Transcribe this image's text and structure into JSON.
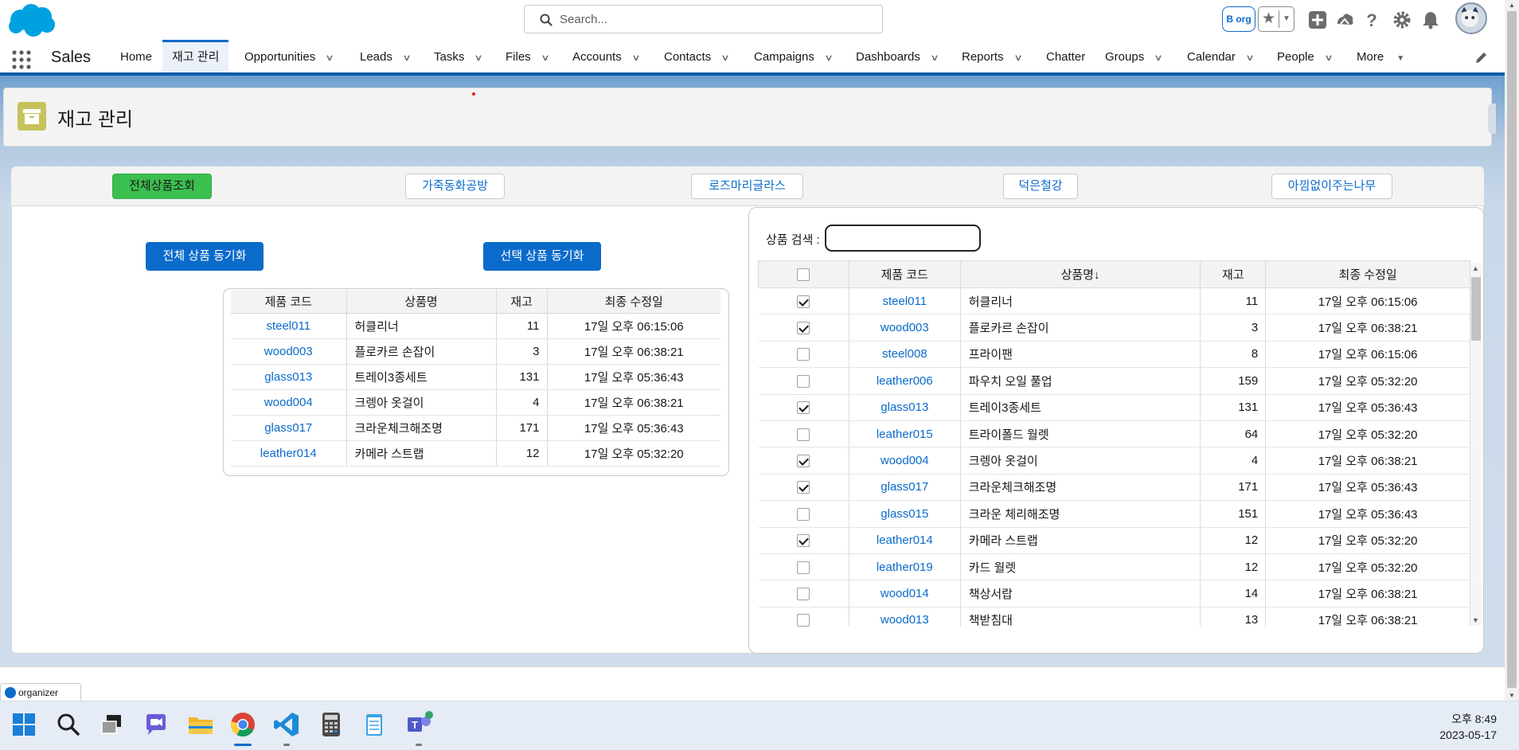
{
  "header": {
    "search_placeholder": "Search...",
    "org_badge": "B org"
  },
  "nav": {
    "app_name": "Sales",
    "items": [
      {
        "label": "Home",
        "dropdown": false
      },
      {
        "label": "재고 관리",
        "dropdown": false,
        "active": true
      },
      {
        "label": "Opportunities",
        "dropdown": true
      },
      {
        "label": "Leads",
        "dropdown": true
      },
      {
        "label": "Tasks",
        "dropdown": true
      },
      {
        "label": "Files",
        "dropdown": true
      },
      {
        "label": "Accounts",
        "dropdown": true
      },
      {
        "label": "Contacts",
        "dropdown": true
      },
      {
        "label": "Campaigns",
        "dropdown": true
      },
      {
        "label": "Dashboards",
        "dropdown": true
      },
      {
        "label": "Reports",
        "dropdown": true
      },
      {
        "label": "Chatter",
        "dropdown": false
      },
      {
        "label": "Groups",
        "dropdown": true
      },
      {
        "label": "Calendar",
        "dropdown": true
      },
      {
        "label": "People",
        "dropdown": true
      },
      {
        "label": "More",
        "dropdown": true
      }
    ]
  },
  "page": {
    "title": "재고 관리"
  },
  "tabs": [
    {
      "label": "전체상품조회",
      "active": true
    },
    {
      "label": "가죽동화공방",
      "active": false
    },
    {
      "label": "로즈마리글라스",
      "active": false
    },
    {
      "label": "덕은철강",
      "active": false
    },
    {
      "label": "아낌없이주는나무",
      "active": false
    }
  ],
  "buttons": {
    "sync_all": "전체 상품 동기화",
    "sync_selected": "선택 상품 동기화"
  },
  "selected_table": {
    "columns": [
      "제품 코드",
      "상품명",
      "재고",
      "최종 수정일"
    ],
    "rows": [
      [
        "steel011",
        "허클리너",
        "11",
        "17일 오후 06:15:06"
      ],
      [
        "wood003",
        "플로카르 손잡이",
        "3",
        "17일 오후 06:38:21"
      ],
      [
        "glass013",
        "트레이3종세트",
        "131",
        "17일 오후 05:36:43"
      ],
      [
        "wood004",
        "크렝아 옷걸이",
        "4",
        "17일 오후 06:38:21"
      ],
      [
        "glass017",
        "크라운체크해조명",
        "171",
        "17일 오후 05:36:43"
      ],
      [
        "leather014",
        "카메라 스트랩",
        "12",
        "17일 오후 05:32:20"
      ]
    ]
  },
  "product_search": {
    "label": "상품 검색 :",
    "value": ""
  },
  "product_table": {
    "columns": [
      "",
      "제품 코드",
      "상품명↓",
      "재고",
      "최종 수정일"
    ],
    "rows": [
      {
        "checked": true,
        "code": "steel011",
        "name": "허클리너",
        "stock": "11",
        "updated": "17일 오후 06:15:06"
      },
      {
        "checked": true,
        "code": "wood003",
        "name": "플로카르 손잡이",
        "stock": "3",
        "updated": "17일 오후 06:38:21"
      },
      {
        "checked": false,
        "code": "steel008",
        "name": "프라이팬",
        "stock": "8",
        "updated": "17일 오후 06:15:06"
      },
      {
        "checked": false,
        "code": "leather006",
        "name": "파우치 오일 풀업",
        "stock": "159",
        "updated": "17일 오후 05:32:20"
      },
      {
        "checked": true,
        "code": "glass013",
        "name": "트레이3종세트",
        "stock": "131",
        "updated": "17일 오후 05:36:43"
      },
      {
        "checked": false,
        "code": "leather015",
        "name": "트라이폴드 월렛",
        "stock": "64",
        "updated": "17일 오후 05:32:20"
      },
      {
        "checked": true,
        "code": "wood004",
        "name": "크렝아 옷걸이",
        "stock": "4",
        "updated": "17일 오후 06:38:21"
      },
      {
        "checked": true,
        "code": "glass017",
        "name": "크라운체크해조명",
        "stock": "171",
        "updated": "17일 오후 05:36:43"
      },
      {
        "checked": false,
        "code": "glass015",
        "name": "크라운 체리해조명",
        "stock": "151",
        "updated": "17일 오후 05:36:43"
      },
      {
        "checked": true,
        "code": "leather014",
        "name": "카메라 스트랩",
        "stock": "12",
        "updated": "17일 오후 05:32:20"
      },
      {
        "checked": false,
        "code": "leather019",
        "name": "카드 월렛",
        "stock": "12",
        "updated": "17일 오후 05:32:20"
      },
      {
        "checked": false,
        "code": "wood014",
        "name": "책상서랍",
        "stock": "14",
        "updated": "17일 오후 06:38:21"
      },
      {
        "checked": false,
        "code": "wood013",
        "name": "책받침대",
        "stock": "13",
        "updated": "17일 오후 06:38:21"
      }
    ]
  },
  "utility_bar": {
    "organizer_label": "organizer"
  },
  "taskbar": {
    "time": "오후 8:49",
    "date": "2023-05-17"
  },
  "colors": {
    "brand_blue": "#0b6bcb",
    "active_tab_green": "#3bbf4f",
    "page_icon": "#c7c25b"
  }
}
